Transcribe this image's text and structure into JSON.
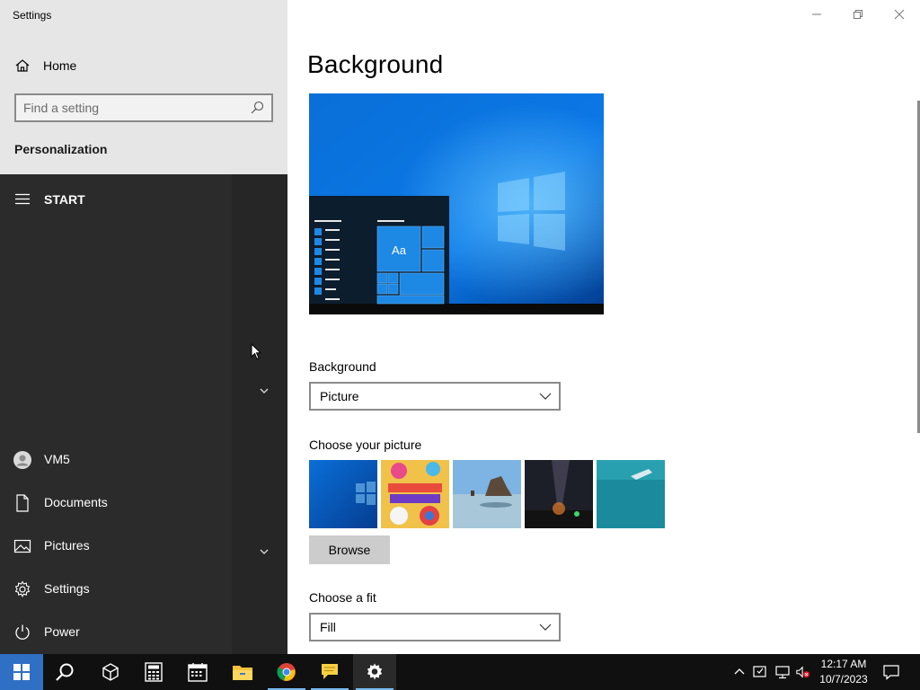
{
  "window": {
    "title": "Settings",
    "minimize_icon": "minimize-icon",
    "restore_icon": "restore-icon",
    "close_icon": "close-icon"
  },
  "sidebar": {
    "home_label": "Home",
    "search_placeholder": "Find a setting",
    "section_title": "Personalization"
  },
  "main": {
    "page_title": "Background",
    "preview_tile_text": "Aa",
    "background_label": "Background",
    "background_value": "Picture",
    "choose_picture_label": "Choose your picture",
    "pictures": [
      "windows-blue-light",
      "digital-circus",
      "beach-rocks",
      "night-sky",
      "underwater-swimmer"
    ],
    "browse_label": "Browse",
    "fit_label": "Choose a fit",
    "fit_value": "Fill"
  },
  "start_menu": {
    "header": "START",
    "items": [
      {
        "label": "VM5",
        "icon": "user-avatar-icon"
      },
      {
        "label": "Documents",
        "icon": "document-icon"
      },
      {
        "label": "Pictures",
        "icon": "pictures-icon"
      },
      {
        "label": "Settings",
        "icon": "gear-icon"
      },
      {
        "label": "Power",
        "icon": "power-icon"
      }
    ]
  },
  "taskbar": {
    "apps": [
      "windows-start",
      "search",
      "3d-viewer",
      "calculator",
      "calendar",
      "file-explorer",
      "chrome",
      "sticky-notes",
      "settings"
    ],
    "time": "12:17 AM",
    "date": "10/7/2023"
  },
  "colors": {
    "accent": "#0078d7",
    "start_bg": "#2b2b2b",
    "taskbar_bg": "#101010",
    "sidebar_bg": "#e6e6e6"
  }
}
